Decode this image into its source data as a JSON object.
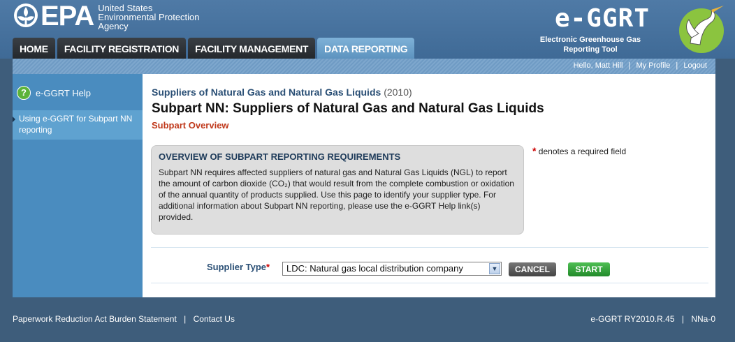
{
  "header": {
    "epa": "EPA",
    "agency_lines": [
      "United States",
      "Environmental Protection",
      "Agency"
    ],
    "app_name": "e-GGRT",
    "app_sub_lines": [
      "Electronic Greenhouse Gas",
      "Reporting Tool"
    ]
  },
  "tabs": [
    {
      "label": "HOME",
      "active": false
    },
    {
      "label": "FACILITY REGISTRATION",
      "active": false
    },
    {
      "label": "FACILITY MANAGEMENT",
      "active": false
    },
    {
      "label": "DATA REPORTING",
      "active": true
    }
  ],
  "userbar": {
    "greeting": "Hello, Matt Hill",
    "profile": "My Profile",
    "logout": "Logout",
    "separator": "|"
  },
  "sidebar": {
    "help": "e-GGRT Help",
    "link": "Using e-GGRT for Subpart NN reporting"
  },
  "main": {
    "crumb": "Suppliers of Natural Gas and Natural Gas Liquids",
    "crumb_year": "(2010)",
    "title": "Subpart NN: Suppliers of Natural Gas and Natural Gas Liquids",
    "subtitle": "Subpart Overview",
    "overview_heading": "OVERVIEW OF SUBPART REPORTING REQUIREMENTS",
    "overview_body": "Subpart NN requires affected suppliers of natural gas and Natural Gas Liquids (NGL) to report the amount of carbon dioxide (CO₂) that would result from the complete combustion or oxidation of the annual quantity of products supplied. Use this page to identify your supplier type. For additional information about Subpart NN reporting, please use the e-GGRT Help link(s) provided.",
    "required_star": "*",
    "required_note": "denotes a required field"
  },
  "form": {
    "supplier_label": "Supplier Type",
    "supplier_value": "LDC: Natural gas local distribution company",
    "cancel": "CANCEL",
    "start": "START"
  },
  "footer": {
    "paperwork": "Paperwork Reduction Act Burden Statement",
    "contact": "Contact Us",
    "version": "e-GGRT RY2010.R.45",
    "page_id": "NNa-0",
    "separator": "|"
  },
  "colors": {
    "accent": "#4a8cbf",
    "start": "#2ea336",
    "required": "#cc0000",
    "subtitle": "#c0391b"
  }
}
